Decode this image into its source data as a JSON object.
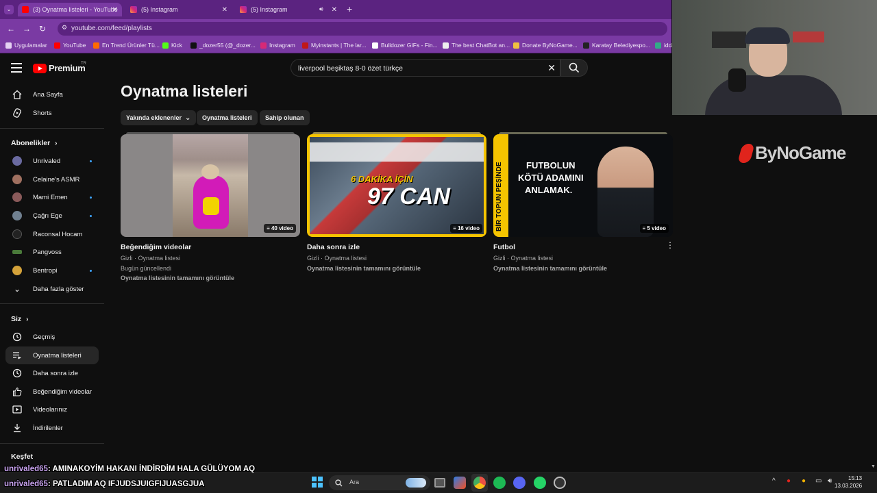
{
  "browser": {
    "tabs": [
      {
        "label": "(3) Oynatma listeleri - YouTube",
        "icon": "youtube-icon",
        "active": true
      },
      {
        "label": "(5) Instagram",
        "icon": "instagram-icon",
        "active": false
      },
      {
        "label": "(5) Instagram",
        "icon": "instagram-icon",
        "active": false
      }
    ],
    "new_tab": "+",
    "url": "youtube.com/feed/playlists",
    "bookmarks": [
      "Uygulamalar",
      "YouTube",
      "En Trend Ürünler Tü...",
      "Kick",
      "_dozer55 (@_dozer...",
      "Instagram",
      "Myinstants | The lar...",
      "Bulldozer GIFs - Fin...",
      "The best ChatBot an...",
      "Donate ByNoGame...",
      "Karatay Belediyespo...",
      "idda"
    ]
  },
  "header": {
    "brand": "Premium",
    "brand_region": "TR",
    "search_value": "liverpool beşiktaş 8-0 özet türkçe"
  },
  "sidebar": {
    "primary": [
      {
        "label": "Ana Sayfa",
        "icon": "home-icon"
      },
      {
        "label": "Shorts",
        "icon": "shorts-icon"
      }
    ],
    "subscriptions_heading": "Abonelikler",
    "subscriptions": [
      {
        "label": "Unrivaled",
        "dot": true,
        "color": "#6a6aa0"
      },
      {
        "label": "Celaine's ASMR",
        "dot": false,
        "color": "#a07060"
      },
      {
        "label": "Mami Emen",
        "dot": true,
        "color": "#8a5a5a"
      },
      {
        "label": "Çağrı Ege",
        "dot": true,
        "color": "#708090"
      },
      {
        "label": "Raconsal Hocam",
        "dot": false,
        "color": "#222222"
      },
      {
        "label": "Pangvoss",
        "dot": false,
        "color": "#4a7a3a"
      },
      {
        "label": "Bentropi",
        "dot": true,
        "color": "#d4a23a"
      }
    ],
    "show_more": "Daha fazla göster",
    "you_heading": "Siz",
    "you_items": [
      {
        "label": "Geçmiş",
        "icon": "history-icon"
      },
      {
        "label": "Oynatma listeleri",
        "icon": "playlists-icon",
        "active": true
      },
      {
        "label": "Daha sonra izle",
        "icon": "clock-icon"
      },
      {
        "label": "Beğendiğim videolar",
        "icon": "thumbs-up-icon"
      },
      {
        "label": "Videolarınız",
        "icon": "your-videos-icon"
      },
      {
        "label": "İndirilenler",
        "icon": "download-icon"
      }
    ],
    "explore_heading": "Keşfet"
  },
  "main": {
    "title": "Oynatma listeleri",
    "sort_chip": "Yakında eklenenler",
    "chips": [
      "Oynatma listeleri",
      "Sahip olunan"
    ],
    "playlists": [
      {
        "title": "Beğendiğim videolar",
        "meta": "Gizli · Oynatma listesi",
        "updated": "Bugün güncellendi",
        "link": "Oynatma listesinin tamamını görüntüle",
        "count": "40 video"
      },
      {
        "title": "Daha sonra izle",
        "meta": "Gizli · Oynatma listesi",
        "updated": "",
        "link": "Oynatma listesinin tamamını görüntüle",
        "count": "16 video",
        "thumb_text": [
          "6 DAKİKA İÇİN",
          "97 CAN"
        ]
      },
      {
        "title": "Futbol",
        "meta": "Gizli · Oynatma listesi",
        "updated": "",
        "link": "Oynatma listesinin tamamını görüntüle",
        "count": "5 video",
        "thumb_text": [
          "FUTBOLUN",
          "KÖTÜ ADAMINI",
          "ANLAMAK.",
          "BİR TOPUN PEŞİNDE"
        ]
      }
    ]
  },
  "overlay": {
    "sponsor": "ByNoGame",
    "chat": [
      {
        "user": "unrivaled65",
        "message": ": AMINAKOYİM HAKANI İNDİRDİM HALA GÜLÜYOM AQ"
      },
      {
        "user": "unrivaled65",
        "message": ": PATLADIM AQ IFJUDSJUIGFIJUASGJUA"
      }
    ]
  },
  "taskbar": {
    "search_placeholder": "Ara",
    "time": "15:13",
    "date": "13.03.2026"
  },
  "colors": {
    "youtube_red": "#ff0000",
    "browser_purple": "#7a3aa3",
    "accent_blue": "#3ea6ff"
  }
}
